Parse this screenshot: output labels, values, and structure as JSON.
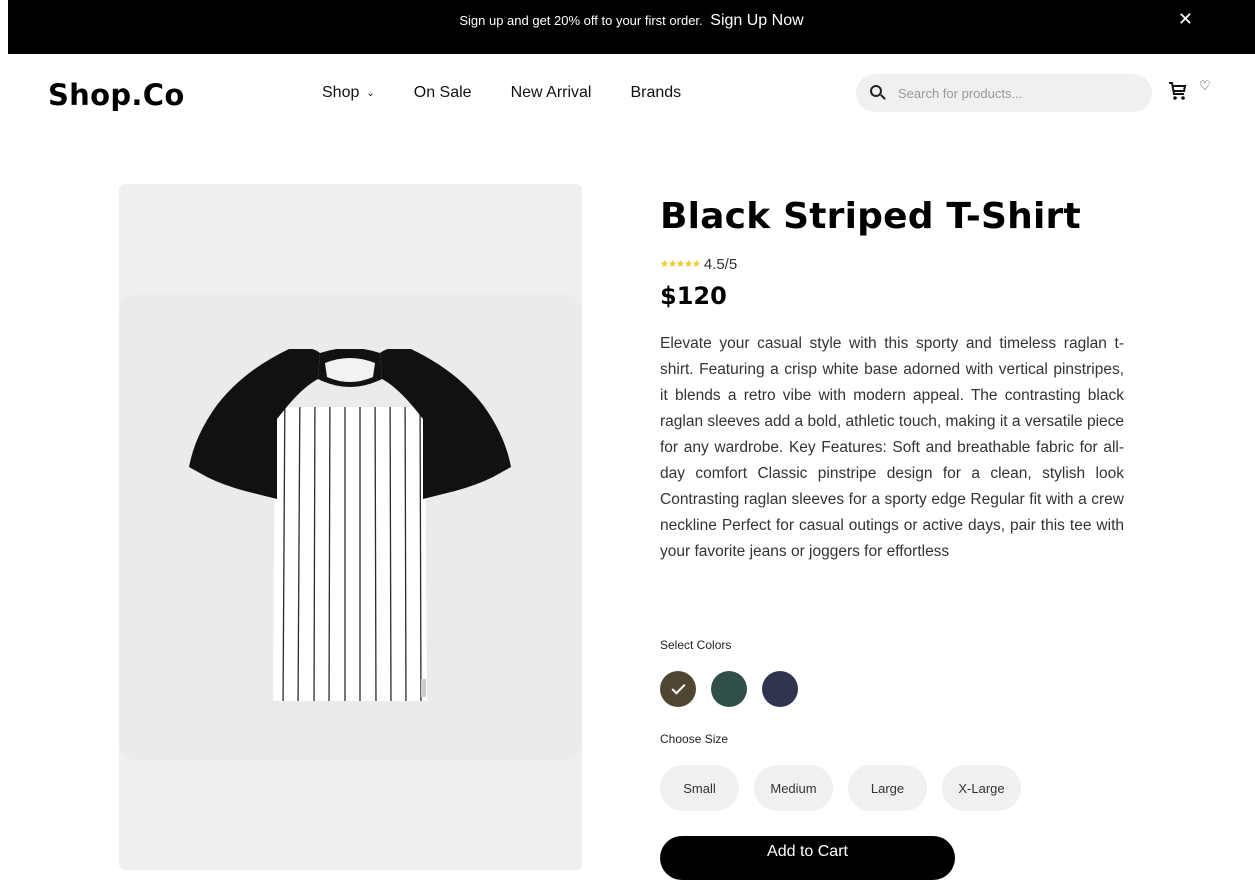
{
  "promo": {
    "text": "Sign up and get 20% off to your first order.",
    "link": "Sign Up Now",
    "close": "✕"
  },
  "header": {
    "logo": "Shop.Co",
    "nav": [
      "Shop",
      "On Sale",
      "New Arrival",
      "Brands"
    ],
    "search_placeholder": "Search for products...",
    "icons": [
      "search-icon",
      "cart-icon",
      "heart-icon"
    ]
  },
  "product": {
    "title": "Black Striped T-Shirt",
    "rating": "4.5/5",
    "rating_value": 4.5,
    "rating_max": 5,
    "price": "$120",
    "description": "Elevate your casual style with this sporty and timeless raglan t-shirt. Featuring a crisp white base adorned with vertical pinstripes, it blends a retro vibe with modern appeal. The contrasting black raglan sleeves add a bold, athletic touch, making it a versatile piece for any wardrobe. Key Features: Soft and breathable fabric for all-day comfort Classic pinstripe design for a clean, stylish look Contrasting raglan sleeves for a sporty edge Regular fit with a crew neckline Perfect for casual outings or active days, pair this tee with your favorite jeans or joggers for effortless",
    "colors_label": "Select Colors",
    "colors": [
      {
        "hex": "#4f4631",
        "selected": true
      },
      {
        "hex": "#314f4a",
        "selected": false
      },
      {
        "hex": "#31344f",
        "selected": false
      }
    ],
    "size_label": "Choose Size",
    "sizes": [
      "Small",
      "Medium",
      "Large",
      "X-Large"
    ],
    "add_to_cart": "Add to Cart"
  },
  "colors": {
    "promo_bg": "#000000",
    "panel_bg": "#f1efee",
    "pill_bg": "#f0f0f0",
    "star": "#f5c518"
  }
}
